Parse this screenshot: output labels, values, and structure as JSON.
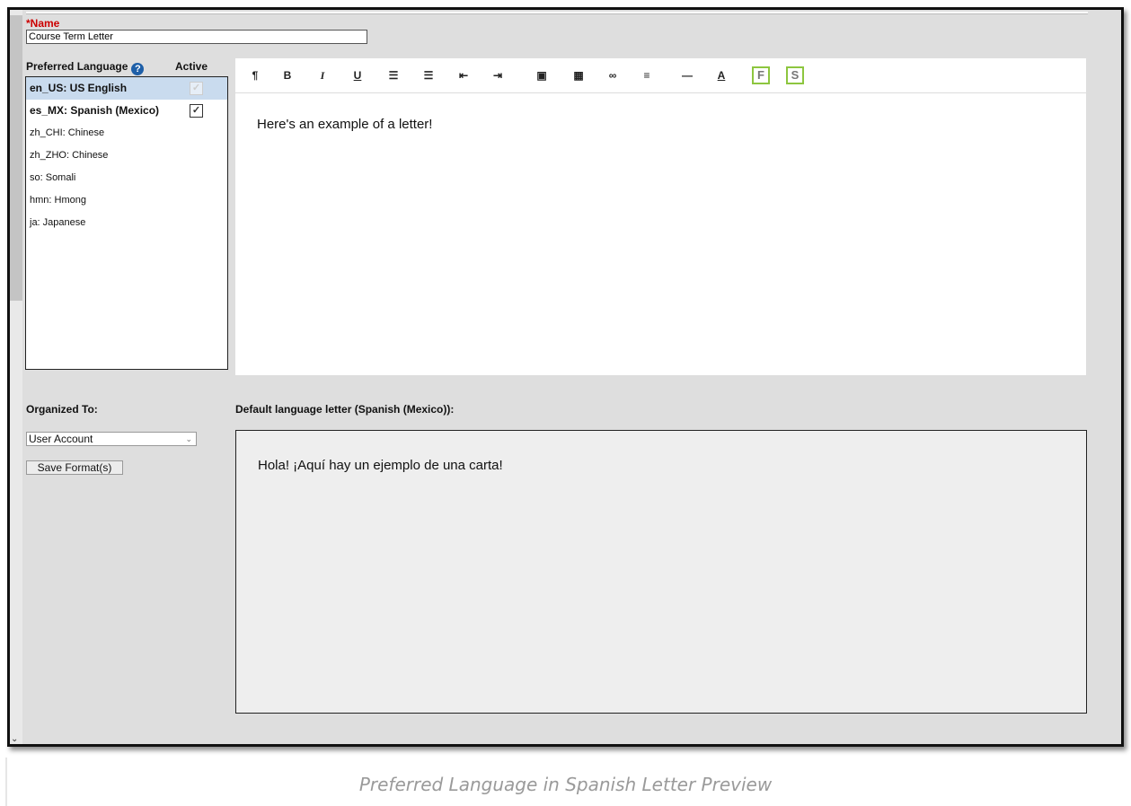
{
  "form": {
    "name_label": "*Name",
    "name_value": "Course Term Letter",
    "preferred_language_label": "Preferred Language",
    "help_glyph": "?",
    "active_label": "Active",
    "languages": [
      {
        "label": "en_US: US English",
        "checked": true,
        "selected": true
      },
      {
        "label": "es_MX: Spanish (Mexico)",
        "checked": true,
        "selected": false
      },
      {
        "label": "zh_CHI: Chinese",
        "checked": false,
        "selected": false
      },
      {
        "label": "zh_ZHO: Chinese",
        "checked": false,
        "selected": false
      },
      {
        "label": "so: Somali",
        "checked": false,
        "selected": false
      },
      {
        "label": "hmn: Hmong",
        "checked": false,
        "selected": false
      },
      {
        "label": "ja: Japanese",
        "checked": false,
        "selected": false
      }
    ],
    "check_glyph": "✓"
  },
  "editor": {
    "toolbar": {
      "paragraph": "¶",
      "bold": "B",
      "italic": "I",
      "underline": "U",
      "bullet_list": "☰",
      "numbered_list": "☰",
      "outdent": "⇤",
      "indent": "⇥",
      "image": "▣",
      "table": "▦",
      "link": "∞",
      "align": "≡",
      "hr": "—",
      "font_color": "A",
      "field_f": "F",
      "field_s": "S"
    },
    "content": "Here's an example of a letter!"
  },
  "organized_to": {
    "label": "Organized To:",
    "selected": "User Account",
    "chevron": "⌄"
  },
  "save_button": "Save Format(s)",
  "default_letter": {
    "label": "Default language letter (Spanish (Mexico)):",
    "content": "Hola! ¡Aquí hay un ejemplo de una carta!"
  },
  "caption": "Preferred Language in Spanish Letter Preview"
}
